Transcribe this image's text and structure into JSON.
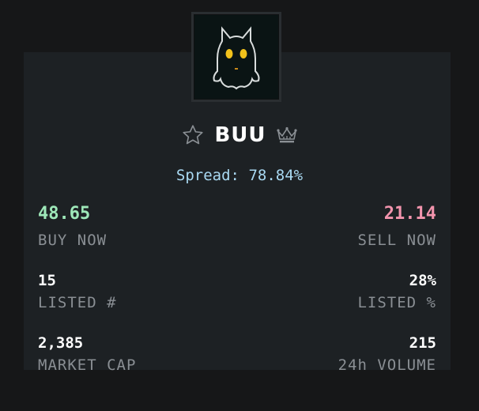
{
  "token": {
    "name": "BUU",
    "spread_label": "Spread:",
    "spread_value": "78.84%"
  },
  "stats": {
    "buy_now_value": "48.65",
    "buy_now_label": "BUY NOW",
    "sell_now_value": "21.14",
    "sell_now_label": "SELL NOW",
    "listed_count_value": "15",
    "listed_count_label": "LISTED #",
    "listed_pct_value": "28%",
    "listed_pct_label": "LISTED %",
    "market_cap_value": "2,385",
    "market_cap_label": "MARKET CAP",
    "volume_value": "215",
    "volume_label": "24h VOLUME"
  },
  "icons": {
    "favorite": "star-outline-icon",
    "tier": "crown-icon"
  },
  "colors": {
    "background": "#161718",
    "card": "#1d2124",
    "buy": "#9ee8b9",
    "sell": "#f294ad",
    "spread": "#a9d9f2",
    "label": "#8a8f94"
  }
}
